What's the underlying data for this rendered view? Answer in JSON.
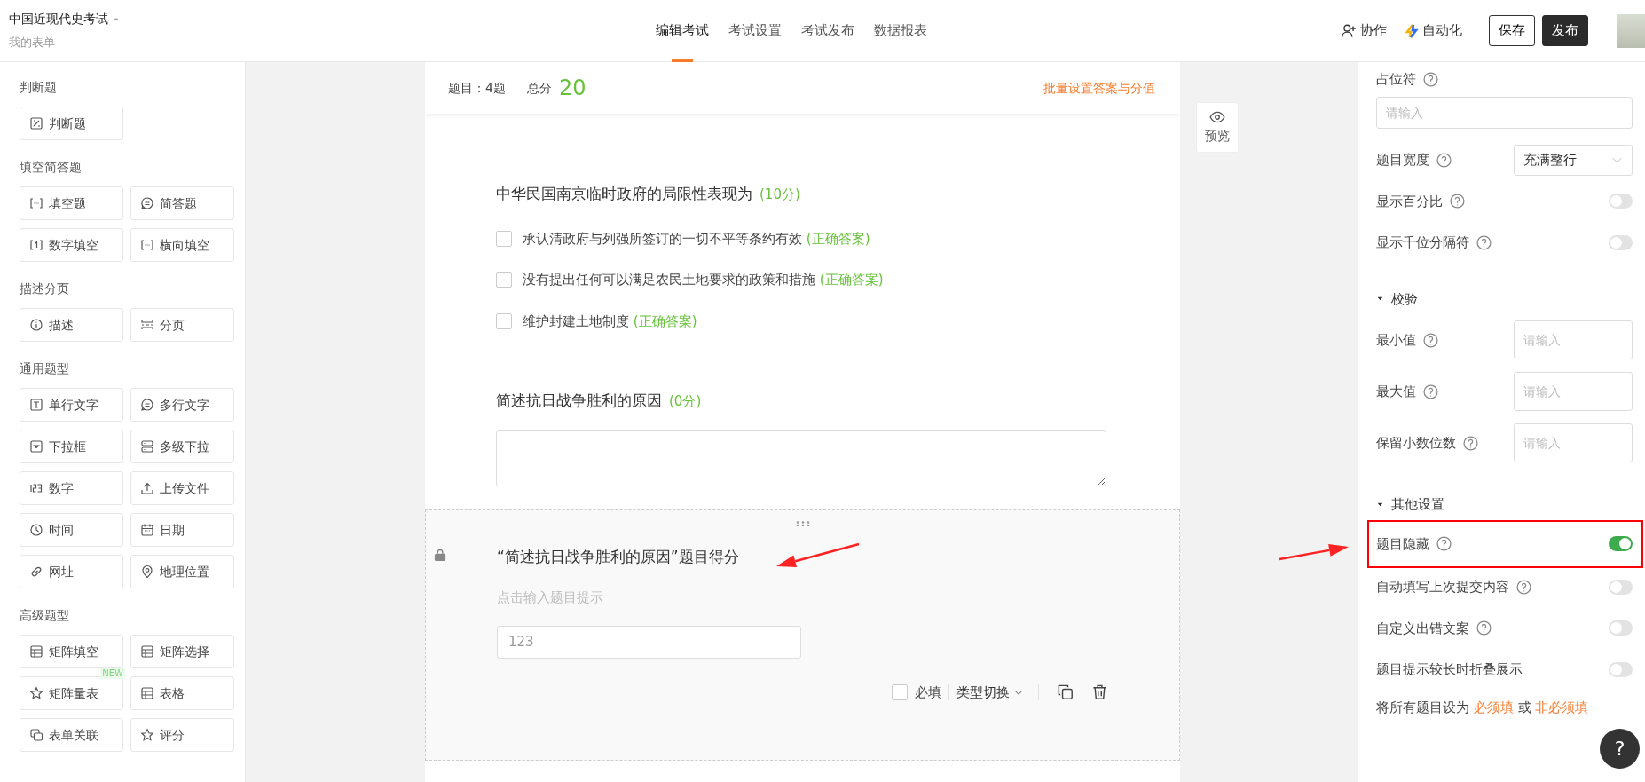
{
  "app": {
    "title": "中国近现代史考试",
    "subtitle": "我的表单"
  },
  "nav_tabs": [
    {
      "label": "编辑考试",
      "selected": true
    },
    {
      "label": "考试设置",
      "selected": false
    },
    {
      "label": "考试发布",
      "selected": false
    },
    {
      "label": "数据报表",
      "selected": false
    }
  ],
  "header_actions": {
    "collaborate": "协作",
    "automation": "自动化",
    "save": "保存",
    "publish": "发布"
  },
  "sidebar": {
    "groups": [
      {
        "title": "判断题",
        "items": [
          {
            "label": "判断题",
            "kind": "judge"
          }
        ]
      },
      {
        "title": "填空简答题",
        "items": [
          {
            "label": "填空题",
            "kind": "blank"
          },
          {
            "label": "简答题",
            "kind": "essay"
          },
          {
            "label": "数字填空",
            "kind": "numblank"
          },
          {
            "label": "横向填空",
            "kind": "blank"
          }
        ]
      },
      {
        "title": "描述分页",
        "items": [
          {
            "label": "描述",
            "kind": "info"
          },
          {
            "label": "分页",
            "kind": "page"
          }
        ]
      },
      {
        "title": "通用题型",
        "items": [
          {
            "label": "单行文字",
            "kind": "textbox"
          },
          {
            "label": "多行文字",
            "kind": "essay"
          },
          {
            "label": "下拉框",
            "kind": "dropdown"
          },
          {
            "label": "多级下拉",
            "kind": "cascade"
          },
          {
            "label": "数字",
            "kind": "digits"
          },
          {
            "label": "上传文件",
            "kind": "upload"
          },
          {
            "label": "时间",
            "kind": "time"
          },
          {
            "label": "日期",
            "kind": "date"
          },
          {
            "label": "网址",
            "kind": "url"
          },
          {
            "label": "地理位置",
            "kind": "location"
          }
        ]
      },
      {
        "title": "高级题型",
        "items": [
          {
            "label": "矩阵填空",
            "kind": "matrix"
          },
          {
            "label": "矩阵选择",
            "kind": "matrix"
          },
          {
            "label": "矩阵量表",
            "kind": "scale",
            "badge": "NEW"
          },
          {
            "label": "表格",
            "kind": "matrix"
          },
          {
            "label": "表单关联",
            "kind": "relation"
          },
          {
            "label": "评分",
            "kind": "scale"
          }
        ]
      }
    ]
  },
  "summary": {
    "count": "题目：4题",
    "total_label": "总分",
    "total": "20",
    "batch_link": "批量设置答案与分值"
  },
  "questions": [
    {
      "kind": "multiple_choice",
      "selected": false,
      "title": "中华民国南京临时政府的局限性表现为",
      "score": "(10分)",
      "options": [
        {
          "text": "承认清政府与列强所签订的一切不平等条约有效",
          "tag": "(正确答案)",
          "checked": false
        },
        {
          "text": "没有提出任何可以满足农民土地要求的政策和措施",
          "tag": "(正确答案)",
          "checked": false
        },
        {
          "text": "维护封建土地制度",
          "tag": "(正确答案)",
          "checked": false
        }
      ]
    },
    {
      "kind": "short_answer",
      "selected": false,
      "title": "简述抗日战争胜利的原因",
      "score": "(0分)"
    },
    {
      "kind": "number",
      "selected": true,
      "hidden": true,
      "title": "“简述抗日战争胜利的原因”题目得分",
      "hint": "点击输入题目提示",
      "placeholder": "123",
      "required": false,
      "required_label": "必填",
      "switch_type": "类型切换"
    }
  ],
  "preview": "预览",
  "right_panel": {
    "sections": [
      {
        "rows": [
          {
            "kind": "input_block",
            "label": "占位符",
            "help": true,
            "placeholder": "请输入"
          },
          {
            "kind": "select",
            "label": "题目宽度",
            "help": true,
            "value": "充满整行"
          },
          {
            "kind": "toggle",
            "label": "显示百分比",
            "help": true,
            "on": false
          },
          {
            "kind": "toggle",
            "label": "显示千位分隔符",
            "help": true,
            "on": false
          }
        ]
      },
      {
        "title": "校验",
        "expanded": true,
        "rows": [
          {
            "kind": "input_inline",
            "label": "最小值",
            "help": true,
            "placeholder": "请输入"
          },
          {
            "kind": "input_inline",
            "label": "最大值",
            "help": true,
            "placeholder": "请输入"
          },
          {
            "kind": "input_inline",
            "label": "保留小数位数",
            "help": true,
            "placeholder": "请输入"
          }
        ]
      },
      {
        "title": "其他设置",
        "expanded": true,
        "rows": [
          {
            "kind": "toggle",
            "label": "题目隐藏",
            "help": true,
            "on": true,
            "highlighted": true
          },
          {
            "kind": "toggle",
            "label": "自动填写上次提交内容",
            "help": true,
            "on": false,
            "highlighted": false
          },
          {
            "kind": "toggle",
            "label": "自定义出错文案",
            "help": true,
            "on": false,
            "highlighted": false
          },
          {
            "kind": "toggle",
            "label": "题目提示较长时折叠展示",
            "help": false,
            "on": false,
            "highlighted": false
          }
        ]
      }
    ],
    "footer": {
      "prefix": "将所有题目设为",
      "required_link": "必须填",
      "joiner": "或",
      "optional_link": "非必须填"
    }
  },
  "help_button": "?"
}
